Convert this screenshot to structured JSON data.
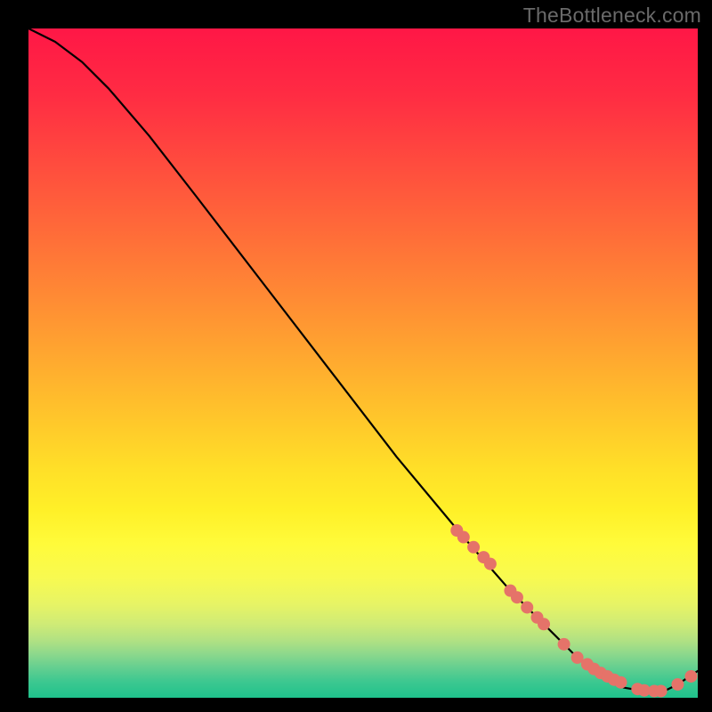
{
  "watermark": "TheBottleneck.com",
  "gradient": {
    "stops": [
      {
        "offset": 0.0,
        "color": "#ff1746"
      },
      {
        "offset": 0.1,
        "color": "#ff2c43"
      },
      {
        "offset": 0.2,
        "color": "#ff4b3e"
      },
      {
        "offset": 0.3,
        "color": "#ff6a39"
      },
      {
        "offset": 0.4,
        "color": "#ff8a34"
      },
      {
        "offset": 0.5,
        "color": "#ffab2f"
      },
      {
        "offset": 0.6,
        "color": "#ffcc2a"
      },
      {
        "offset": 0.66,
        "color": "#ffe028"
      },
      {
        "offset": 0.72,
        "color": "#fff028"
      },
      {
        "offset": 0.77,
        "color": "#fffb3a"
      },
      {
        "offset": 0.82,
        "color": "#f8fa50"
      },
      {
        "offset": 0.86,
        "color": "#e7f465"
      },
      {
        "offset": 0.89,
        "color": "#cfeb76"
      },
      {
        "offset": 0.915,
        "color": "#b0e183"
      },
      {
        "offset": 0.935,
        "color": "#8cd88c"
      },
      {
        "offset": 0.955,
        "color": "#64cf90"
      },
      {
        "offset": 0.975,
        "color": "#3ec890"
      },
      {
        "offset": 1.0,
        "color": "#1fc28c"
      }
    ]
  },
  "chart_data": {
    "type": "line",
    "title": "",
    "xlabel": "",
    "ylabel": "",
    "xlim": [
      0,
      100
    ],
    "ylim": [
      0,
      100
    ],
    "series": [
      {
        "name": "curve",
        "x": [
          0,
          4,
          8,
          12,
          18,
          25,
          35,
          45,
          55,
          65,
          72,
          78,
          82,
          86,
          89,
          92,
          95,
          97,
          100
        ],
        "y": [
          100,
          98,
          95,
          91,
          84,
          75,
          62,
          49,
          36,
          24,
          16,
          10,
          6,
          3,
          1.5,
          1,
          1,
          2,
          4
        ]
      }
    ],
    "markers": {
      "name": "highlight-dots",
      "color": "#e57369",
      "x": [
        64,
        65,
        66.5,
        68,
        69,
        72,
        73,
        74.5,
        76,
        77,
        80,
        82,
        83.5,
        84.5,
        85.5,
        86.5,
        87.5,
        88.5,
        91,
        92,
        93.5,
        94.5,
        97,
        99
      ],
      "y": [
        25,
        24,
        22.5,
        21,
        20,
        16,
        15,
        13.5,
        12,
        11,
        8,
        6,
        5,
        4.3,
        3.7,
        3.2,
        2.7,
        2.3,
        1.3,
        1.1,
        1.0,
        1.0,
        2.0,
        3.2
      ],
      "r": 7
    }
  }
}
